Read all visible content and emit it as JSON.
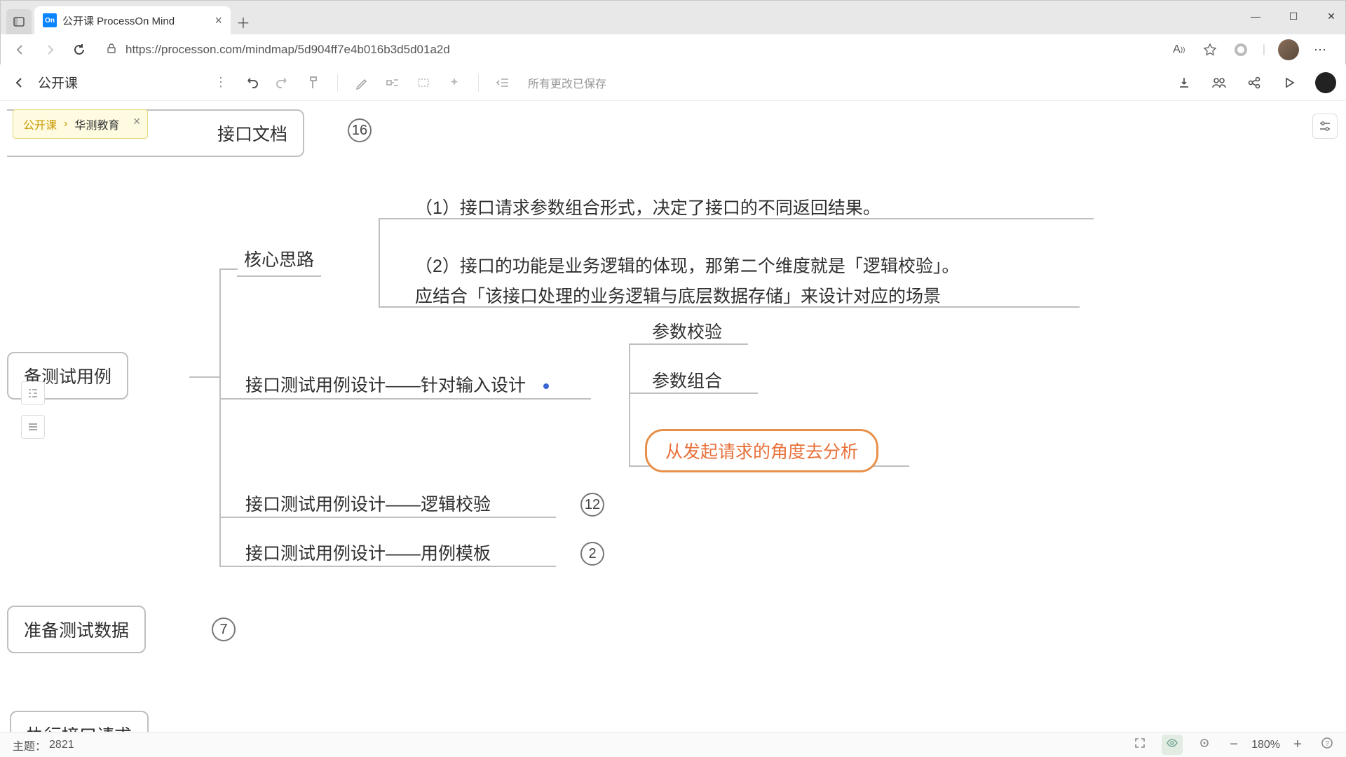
{
  "browser": {
    "tab_title": "公开课 ProcessOn Mind",
    "favicon": "On",
    "url": "https://processon.com/mindmap/5d904ff7e4b016b3d5d01a2d"
  },
  "app": {
    "doc_title": "公开课",
    "save_status": "所有更改已保存"
  },
  "breadcrumb": {
    "root": "公开课",
    "current": "华测教育"
  },
  "nodes": {
    "n_root_doc": "接口文档",
    "n_root_doc_count": "16",
    "n_core": "核心思路",
    "n_core_c1": "（1）接口请求参数组合形式，决定了接口的不同返回结果。",
    "n_core_c2a": "（2）接口的功能是业务逻辑的体现，那第二个维度就是「逻辑校验」。",
    "n_core_c2b": "应结合「该接口处理的业务逻辑与底层数据存储」来设计对应的场景",
    "n_prepare": "备测试用例",
    "n_design_input": "接口测试用例设计——针对输入设计",
    "n_param_check": "参数校验",
    "n_param_combo": "参数组合",
    "n_highlight": "从发起请求的角度去分析",
    "n_logic": "接口测试用例设计——逻辑校验",
    "n_logic_count": "12",
    "n_template": "接口测试用例设计——用例模板",
    "n_template_count": "2",
    "n_prepare_data": "准备测试数据",
    "n_prepare_data_count": "7",
    "n_exec": "执行接口请求"
  },
  "status": {
    "theme_label": "主题：",
    "theme_count": "2821",
    "zoom": "180%"
  }
}
